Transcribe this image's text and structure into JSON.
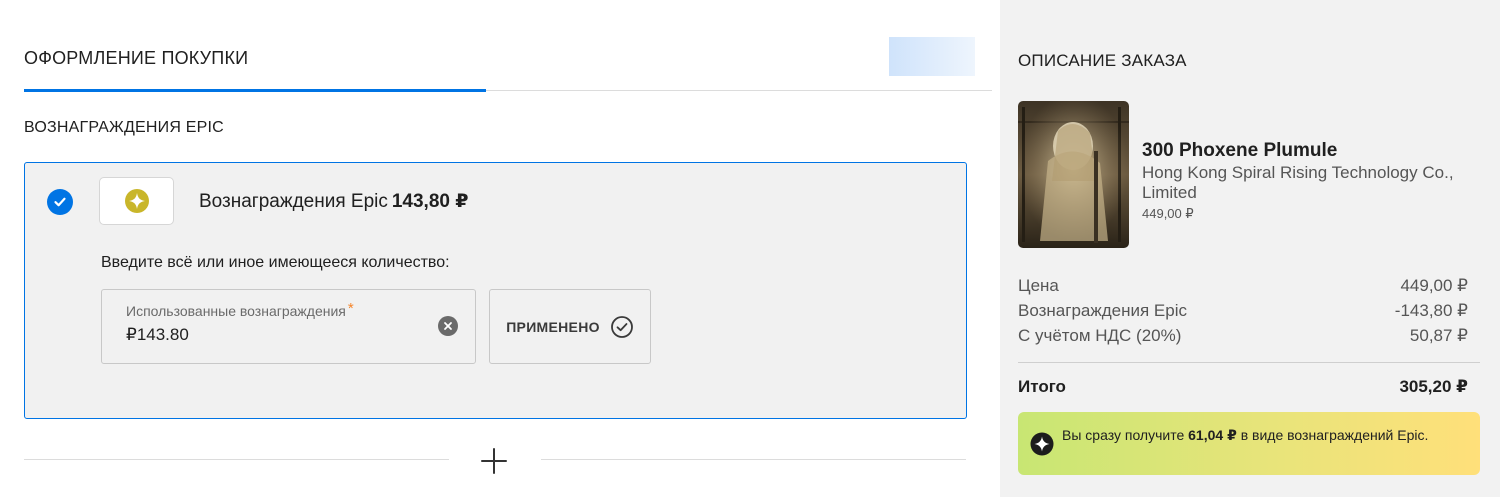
{
  "checkout": {
    "title": "ОФОРМЛЕНИЕ ПОКУПКИ",
    "rewards_heading": "ВОЗНАГРАЖДЕНИЯ EPIC",
    "rewards_panel": {
      "reward_label": "Вознаграждения Epic",
      "reward_amount": "143,80 ₽",
      "amount_hint": "Введите всё или иное имеющееся количество:",
      "field_label": "Использованные вознаграждения",
      "field_required_mark": "*",
      "field_value": "₽143.80",
      "applied_button": "ПРИМЕНЕНО"
    }
  },
  "order_summary": {
    "title": "ОПИСАНИЕ ЗАКАЗА",
    "product": {
      "name": "300 Phoxene Plumule",
      "publisher": "Hong Kong Spiral Rising Technology Co., Limited",
      "price": "449,00 ₽"
    },
    "lines": [
      {
        "label": "Цена",
        "value": "449,00 ₽"
      },
      {
        "label": "Вознаграждения Epic",
        "value": "-143,80 ₽"
      },
      {
        "label": "С учётом НДС (20%)",
        "value": "50,87 ₽"
      }
    ],
    "total": {
      "label": "Итого",
      "value": "305,20 ₽"
    },
    "bonus": {
      "prefix": "Вы сразу получите",
      "amount": "61,04 ₽",
      "suffix": "в виде вознаграждений Epic."
    }
  },
  "colors": {
    "accent": "#0074e4",
    "summary_background": "#f2f2f2",
    "banner_start": "#c8e673",
    "banner_end": "#ffe07a"
  },
  "icons": [
    "check-icon",
    "epic-rewards-logo-icon",
    "clear-icon",
    "check-circle-icon",
    "plus-icon",
    "epic-rewards-badge-icon"
  ]
}
